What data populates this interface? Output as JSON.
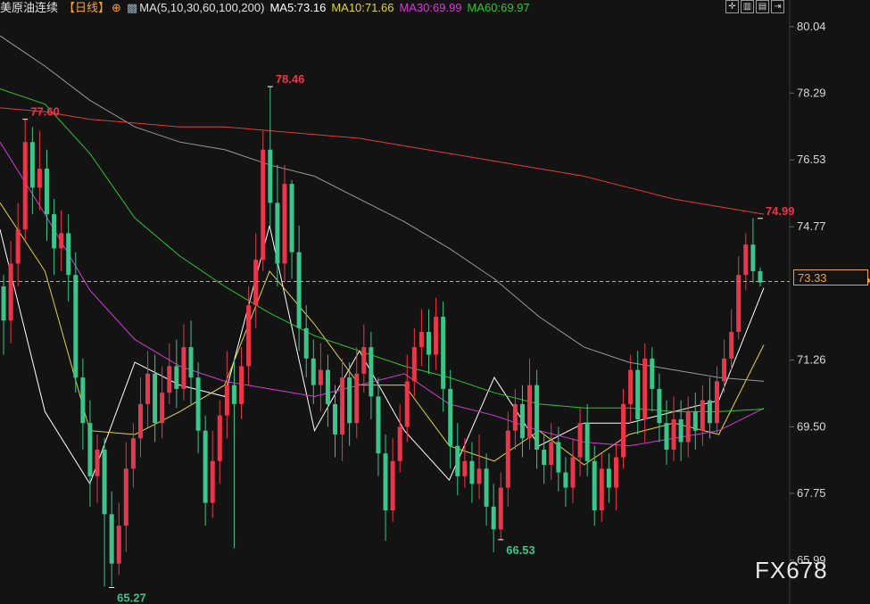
{
  "header": {
    "symbol": "美原油连续",
    "period": "【日线】",
    "ma_label": "MA(5,10,30,60,100,200)",
    "ma5": "MA5:73.16",
    "ma10": "MA10:71.66",
    "ma30": "MA30:69.99",
    "ma60": "MA60:69.97"
  },
  "toolbar": {
    "icons": [
      "crosshair-icon",
      "layout-icon",
      "layout-alt-icon",
      "exit-icon"
    ]
  },
  "current_price": "73.33",
  "watermark": "FX678",
  "colors": {
    "background": "#131313",
    "up": "#e8374a",
    "down": "#3cc48a",
    "ma5": "#ffffff",
    "ma10": "#e3d33b",
    "ma30": "#d63ad6",
    "ma60": "#2fc52f",
    "ma100": "#9a9a9a",
    "ma200": "#e63a3a",
    "current": "#f2a23a"
  },
  "chart_data": {
    "type": "candlestick",
    "ylim": [
      65.0,
      80.6
    ],
    "y_ticks": [
      "80.04",
      "78.29",
      "76.53",
      "74.77",
      "71.26",
      "69.50",
      "67.75",
      "65.99"
    ],
    "current_price": 73.33,
    "annotations": [
      {
        "text": "77.60",
        "value": 77.6,
        "index": 3
      },
      {
        "text": "78.46",
        "value": 78.46,
        "index": 37
      },
      {
        "text": "65.27",
        "value": 65.27,
        "index": 15
      },
      {
        "text": "66.53",
        "value": 66.53,
        "index": 69
      },
      {
        "text": "74.99",
        "value": 74.99,
        "index": 105
      }
    ],
    "candles": [
      [
        73.2,
        72.3,
        73.5,
        71.4
      ],
      [
        72.3,
        73.8,
        74.4,
        71.7
      ],
      [
        73.8,
        74.7,
        75.4,
        73.2
      ],
      [
        74.7,
        77.0,
        77.6,
        74.4
      ],
      [
        77.0,
        75.8,
        77.4,
        75.1
      ],
      [
        75.8,
        76.3,
        77.3,
        75.2
      ],
      [
        76.3,
        75.1,
        76.8,
        74.4
      ],
      [
        75.1,
        74.2,
        75.5,
        73.5
      ],
      [
        74.2,
        74.6,
        75.2,
        73.6
      ],
      [
        74.6,
        73.5,
        75.1,
        72.8
      ],
      [
        73.5,
        70.8,
        74.1,
        70.4
      ],
      [
        70.8,
        69.6,
        71.3,
        68.9
      ],
      [
        69.6,
        68.2,
        70.2,
        67.4
      ],
      [
        68.2,
        68.9,
        69.3,
        67.5
      ],
      [
        68.9,
        67.2,
        69.2,
        65.3
      ],
      [
        67.2,
        65.9,
        67.8,
        65.3
      ],
      [
        65.9,
        66.9,
        67.5,
        65.6
      ],
      [
        66.9,
        68.4,
        69.1,
        66.2
      ],
      [
        68.4,
        69.2,
        69.6,
        67.9
      ],
      [
        69.2,
        70.1,
        70.8,
        68.7
      ],
      [
        70.1,
        70.9,
        71.5,
        69.5
      ],
      [
        70.9,
        69.6,
        71.4,
        69.1
      ],
      [
        69.6,
        70.4,
        71.1,
        69.2
      ],
      [
        70.4,
        71.1,
        71.7,
        70.1
      ],
      [
        71.1,
        70.5,
        71.8,
        70.0
      ],
      [
        70.5,
        71.6,
        72.2,
        70.2
      ],
      [
        71.6,
        70.8,
        72.3,
        70.1
      ],
      [
        70.8,
        69.4,
        71.2,
        68.8
      ],
      [
        69.4,
        67.5,
        69.8,
        66.9
      ],
      [
        67.5,
        68.6,
        69.4,
        67.1
      ],
      [
        68.6,
        69.8,
        70.2,
        68.0
      ],
      [
        69.8,
        70.6,
        71.5,
        69.2
      ],
      [
        70.6,
        70.1,
        71.3,
        66.3
      ],
      [
        70.1,
        71.1,
        71.6,
        69.7
      ],
      [
        71.1,
        72.7,
        73.2,
        70.6
      ],
      [
        72.7,
        73.9,
        74.6,
        72.1
      ],
      [
        73.9,
        76.8,
        77.3,
        73.6
      ],
      [
        76.8,
        75.4,
        78.46,
        74.8
      ],
      [
        75.4,
        73.8,
        76.4,
        73.2
      ],
      [
        73.8,
        75.9,
        76.4,
        73.3
      ],
      [
        75.9,
        74.1,
        76.0,
        73.4
      ],
      [
        74.1,
        72.1,
        74.8,
        71.5
      ],
      [
        72.1,
        71.3,
        72.7,
        70.8
      ],
      [
        71.3,
        70.6,
        71.8,
        70.1
      ],
      [
        70.6,
        71.0,
        71.7,
        69.9
      ],
      [
        71.0,
        70.1,
        71.4,
        69.5
      ],
      [
        70.1,
        69.3,
        70.6,
        68.7
      ],
      [
        69.3,
        70.8,
        71.3,
        68.6
      ],
      [
        70.8,
        69.6,
        71.2,
        69.0
      ],
      [
        69.6,
        70.9,
        71.6,
        69.2
      ],
      [
        70.9,
        71.6,
        72.2,
        70.4
      ],
      [
        71.6,
        70.3,
        72.0,
        69.7
      ],
      [
        70.3,
        68.8,
        70.8,
        68.2
      ],
      [
        68.8,
        67.3,
        69.3,
        66.5
      ],
      [
        67.3,
        68.6,
        69.2,
        67.0
      ],
      [
        68.6,
        69.5,
        70.1,
        68.3
      ],
      [
        69.5,
        70.7,
        71.4,
        69.1
      ],
      [
        70.7,
        71.6,
        72.1,
        70.3
      ],
      [
        71.6,
        72.0,
        72.6,
        71.1
      ],
      [
        72.0,
        71.4,
        72.6,
        70.9
      ],
      [
        71.4,
        72.4,
        72.9,
        71.0
      ],
      [
        72.4,
        70.5,
        72.8,
        69.9
      ],
      [
        70.5,
        69.0,
        71.0,
        68.4
      ],
      [
        69.0,
        68.2,
        69.6,
        67.7
      ],
      [
        68.2,
        68.6,
        69.2,
        67.9
      ],
      [
        68.6,
        68.0,
        69.1,
        67.5
      ],
      [
        68.0,
        68.4,
        69.3,
        67.6
      ],
      [
        68.4,
        67.4,
        68.8,
        66.9
      ],
      [
        67.4,
        66.8,
        68.0,
        66.2
      ],
      [
        66.8,
        67.9,
        68.3,
        66.53
      ],
      [
        67.9,
        69.4,
        69.9,
        67.4
      ],
      [
        69.4,
        70.1,
        70.5,
        68.9
      ],
      [
        70.1,
        69.2,
        70.6,
        68.7
      ],
      [
        69.2,
        70.6,
        71.3,
        68.9
      ],
      [
        70.6,
        68.9,
        71.0,
        68.4
      ],
      [
        68.9,
        68.5,
        69.3,
        68.0
      ],
      [
        68.5,
        69.1,
        69.6,
        68.1
      ],
      [
        69.1,
        68.3,
        69.5,
        67.8
      ],
      [
        68.3,
        67.9,
        68.7,
        67.4
      ],
      [
        67.9,
        68.7,
        69.2,
        67.5
      ],
      [
        68.7,
        69.6,
        70.0,
        68.2
      ],
      [
        69.6,
        68.6,
        70.1,
        68.2
      ],
      [
        68.6,
        67.3,
        69.0,
        66.9
      ],
      [
        67.3,
        68.4,
        68.8,
        67.0
      ],
      [
        68.4,
        67.9,
        68.8,
        67.5
      ],
      [
        67.9,
        68.7,
        69.1,
        67.3
      ],
      [
        68.7,
        70.1,
        70.5,
        68.4
      ],
      [
        70.1,
        71.0,
        71.4,
        69.6
      ],
      [
        71.0,
        69.7,
        71.5,
        69.3
      ],
      [
        69.7,
        71.3,
        71.7,
        69.1
      ],
      [
        71.3,
        70.5,
        71.6,
        69.9
      ],
      [
        70.5,
        69.6,
        70.9,
        69.1
      ],
      [
        69.6,
        68.9,
        70.2,
        68.5
      ],
      [
        68.9,
        69.7,
        70.3,
        68.6
      ],
      [
        69.7,
        69.1,
        70.2,
        68.6
      ],
      [
        69.1,
        69.9,
        70.3,
        68.7
      ],
      [
        69.9,
        69.4,
        70.4,
        68.9
      ],
      [
        69.4,
        70.2,
        70.6,
        69.0
      ],
      [
        70.2,
        69.6,
        70.8,
        69.2
      ],
      [
        69.6,
        70.7,
        71.1,
        69.3
      ],
      [
        70.7,
        71.3,
        71.8,
        70.4
      ],
      [
        71.3,
        72.0,
        72.6,
        71.0
      ],
      [
        72.0,
        73.5,
        74.0,
        71.8
      ],
      [
        73.5,
        74.3,
        74.6,
        73.1
      ],
      [
        74.3,
        73.6,
        74.99,
        73.3
      ],
      [
        73.6,
        73.3,
        73.7,
        73.2
      ]
    ],
    "ma_values": {
      "ma5": [
        74.7,
        69.9,
        68.0,
        71.2,
        70.6,
        70.3,
        74.8,
        69.4,
        71.5,
        69.4,
        68.1,
        70.8,
        69.0,
        69.6,
        69.6,
        69.9,
        70.2,
        73.16
      ],
      "ma10": [
        75.4,
        73.6,
        69.4,
        69.3,
        69.9,
        70.6,
        73.6,
        72.2,
        70.6,
        70.6,
        69.0,
        68.6,
        69.4,
        68.5,
        69.3,
        69.6,
        69.3,
        71.66
      ],
      "ma30": [
        77.0,
        75.1,
        73.1,
        71.8,
        71.1,
        70.7,
        70.5,
        70.3,
        70.6,
        70.9,
        70.1,
        69.8,
        69.4,
        69.1,
        69.0,
        69.2,
        69.4,
        69.99
      ],
      "ma60": [
        78.4,
        78.0,
        76.7,
        75.0,
        74.0,
        73.2,
        72.5,
        71.9,
        71.5,
        71.1,
        70.8,
        70.4,
        70.1,
        70.0,
        70.0,
        69.9,
        69.9,
        69.97
      ],
      "ma100": [
        79.8,
        79.0,
        78.1,
        77.4,
        77.0,
        76.8,
        76.4,
        76.1,
        75.5,
        74.9,
        74.2,
        73.4,
        72.4,
        71.6,
        71.2,
        71.0,
        70.8,
        70.7
      ],
      "ma200": [
        77.9,
        77.8,
        77.6,
        77.5,
        77.4,
        77.4,
        77.3,
        77.2,
        77.1,
        76.9,
        76.7,
        76.5,
        76.3,
        76.1,
        75.8,
        75.5,
        75.3,
        75.1
      ]
    }
  }
}
